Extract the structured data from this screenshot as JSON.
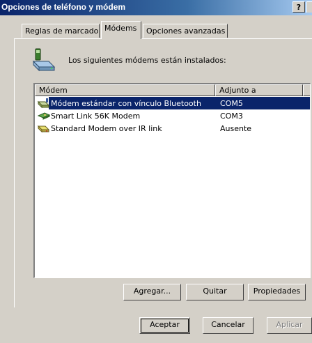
{
  "window": {
    "title": "Opciones de teléfono y módem",
    "help_label": "?"
  },
  "tabs": [
    {
      "label": "Reglas de marcado"
    },
    {
      "label": "Módems"
    },
    {
      "label": "Opciones avanzadas"
    }
  ],
  "modems_tab": {
    "intro": "Los siguientes módems están instalados:",
    "columns": {
      "modem": "Módem",
      "port": "Adjunto a"
    },
    "rows": [
      {
        "name": "Módem estándar con vínculo Bluetooth",
        "port": "COM5",
        "selected": true,
        "icon": "bluetooth-modem-icon"
      },
      {
        "name": "Smart Link 56K Modem",
        "port": "COM3",
        "selected": false,
        "icon": "modem-card-icon"
      },
      {
        "name": "Standard Modem over IR link",
        "port": "Ausente",
        "selected": false,
        "icon": "ir-modem-icon"
      }
    ],
    "buttons": {
      "add": "Agregar...",
      "remove": "Quitar",
      "properties": "Propiedades"
    }
  },
  "dialog_buttons": {
    "ok": "Aceptar",
    "cancel": "Cancelar",
    "apply": "Aplicar"
  },
  "colors": {
    "title_bar": "#0a246a",
    "selection": "#0a246a",
    "face": "#d4d0c8"
  }
}
